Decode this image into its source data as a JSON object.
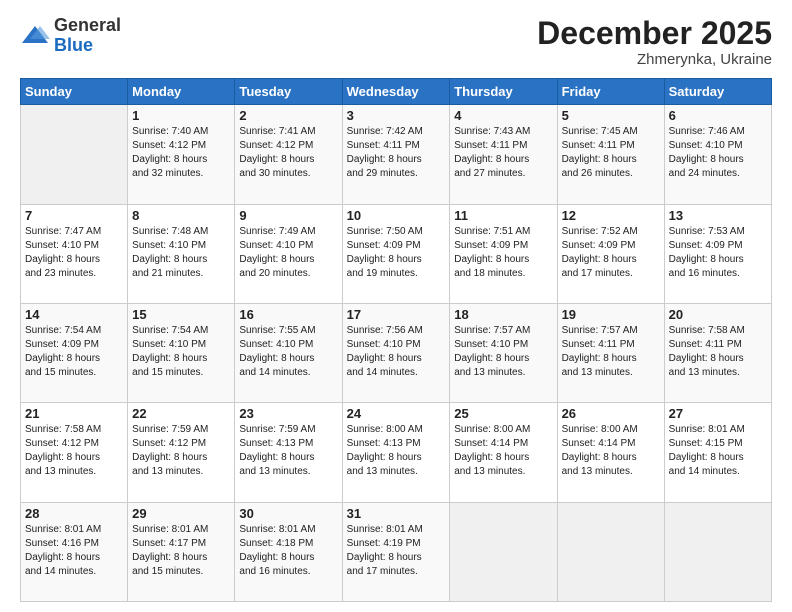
{
  "logo": {
    "general": "General",
    "blue": "Blue"
  },
  "title": "December 2025",
  "location": "Zhmerynka, Ukraine",
  "days_header": [
    "Sunday",
    "Monday",
    "Tuesday",
    "Wednesday",
    "Thursday",
    "Friday",
    "Saturday"
  ],
  "weeks": [
    [
      {
        "day": "",
        "content": ""
      },
      {
        "day": "1",
        "content": "Sunrise: 7:40 AM\nSunset: 4:12 PM\nDaylight: 8 hours\nand 32 minutes."
      },
      {
        "day": "2",
        "content": "Sunrise: 7:41 AM\nSunset: 4:12 PM\nDaylight: 8 hours\nand 30 minutes."
      },
      {
        "day": "3",
        "content": "Sunrise: 7:42 AM\nSunset: 4:11 PM\nDaylight: 8 hours\nand 29 minutes."
      },
      {
        "day": "4",
        "content": "Sunrise: 7:43 AM\nSunset: 4:11 PM\nDaylight: 8 hours\nand 27 minutes."
      },
      {
        "day": "5",
        "content": "Sunrise: 7:45 AM\nSunset: 4:11 PM\nDaylight: 8 hours\nand 26 minutes."
      },
      {
        "day": "6",
        "content": "Sunrise: 7:46 AM\nSunset: 4:10 PM\nDaylight: 8 hours\nand 24 minutes."
      }
    ],
    [
      {
        "day": "7",
        "content": "Sunrise: 7:47 AM\nSunset: 4:10 PM\nDaylight: 8 hours\nand 23 minutes."
      },
      {
        "day": "8",
        "content": "Sunrise: 7:48 AM\nSunset: 4:10 PM\nDaylight: 8 hours\nand 21 minutes."
      },
      {
        "day": "9",
        "content": "Sunrise: 7:49 AM\nSunset: 4:10 PM\nDaylight: 8 hours\nand 20 minutes."
      },
      {
        "day": "10",
        "content": "Sunrise: 7:50 AM\nSunset: 4:09 PM\nDaylight: 8 hours\nand 19 minutes."
      },
      {
        "day": "11",
        "content": "Sunrise: 7:51 AM\nSunset: 4:09 PM\nDaylight: 8 hours\nand 18 minutes."
      },
      {
        "day": "12",
        "content": "Sunrise: 7:52 AM\nSunset: 4:09 PM\nDaylight: 8 hours\nand 17 minutes."
      },
      {
        "day": "13",
        "content": "Sunrise: 7:53 AM\nSunset: 4:09 PM\nDaylight: 8 hours\nand 16 minutes."
      }
    ],
    [
      {
        "day": "14",
        "content": "Sunrise: 7:54 AM\nSunset: 4:09 PM\nDaylight: 8 hours\nand 15 minutes."
      },
      {
        "day": "15",
        "content": "Sunrise: 7:54 AM\nSunset: 4:10 PM\nDaylight: 8 hours\nand 15 minutes."
      },
      {
        "day": "16",
        "content": "Sunrise: 7:55 AM\nSunset: 4:10 PM\nDaylight: 8 hours\nand 14 minutes."
      },
      {
        "day": "17",
        "content": "Sunrise: 7:56 AM\nSunset: 4:10 PM\nDaylight: 8 hours\nand 14 minutes."
      },
      {
        "day": "18",
        "content": "Sunrise: 7:57 AM\nSunset: 4:10 PM\nDaylight: 8 hours\nand 13 minutes."
      },
      {
        "day": "19",
        "content": "Sunrise: 7:57 AM\nSunset: 4:11 PM\nDaylight: 8 hours\nand 13 minutes."
      },
      {
        "day": "20",
        "content": "Sunrise: 7:58 AM\nSunset: 4:11 PM\nDaylight: 8 hours\nand 13 minutes."
      }
    ],
    [
      {
        "day": "21",
        "content": "Sunrise: 7:58 AM\nSunset: 4:12 PM\nDaylight: 8 hours\nand 13 minutes."
      },
      {
        "day": "22",
        "content": "Sunrise: 7:59 AM\nSunset: 4:12 PM\nDaylight: 8 hours\nand 13 minutes."
      },
      {
        "day": "23",
        "content": "Sunrise: 7:59 AM\nSunset: 4:13 PM\nDaylight: 8 hours\nand 13 minutes."
      },
      {
        "day": "24",
        "content": "Sunrise: 8:00 AM\nSunset: 4:13 PM\nDaylight: 8 hours\nand 13 minutes."
      },
      {
        "day": "25",
        "content": "Sunrise: 8:00 AM\nSunset: 4:14 PM\nDaylight: 8 hours\nand 13 minutes."
      },
      {
        "day": "26",
        "content": "Sunrise: 8:00 AM\nSunset: 4:14 PM\nDaylight: 8 hours\nand 13 minutes."
      },
      {
        "day": "27",
        "content": "Sunrise: 8:01 AM\nSunset: 4:15 PM\nDaylight: 8 hours\nand 14 minutes."
      }
    ],
    [
      {
        "day": "28",
        "content": "Sunrise: 8:01 AM\nSunset: 4:16 PM\nDaylight: 8 hours\nand 14 minutes."
      },
      {
        "day": "29",
        "content": "Sunrise: 8:01 AM\nSunset: 4:17 PM\nDaylight: 8 hours\nand 15 minutes."
      },
      {
        "day": "30",
        "content": "Sunrise: 8:01 AM\nSunset: 4:18 PM\nDaylight: 8 hours\nand 16 minutes."
      },
      {
        "day": "31",
        "content": "Sunrise: 8:01 AM\nSunset: 4:19 PM\nDaylight: 8 hours\nand 17 minutes."
      },
      {
        "day": "",
        "content": ""
      },
      {
        "day": "",
        "content": ""
      },
      {
        "day": "",
        "content": ""
      }
    ]
  ]
}
